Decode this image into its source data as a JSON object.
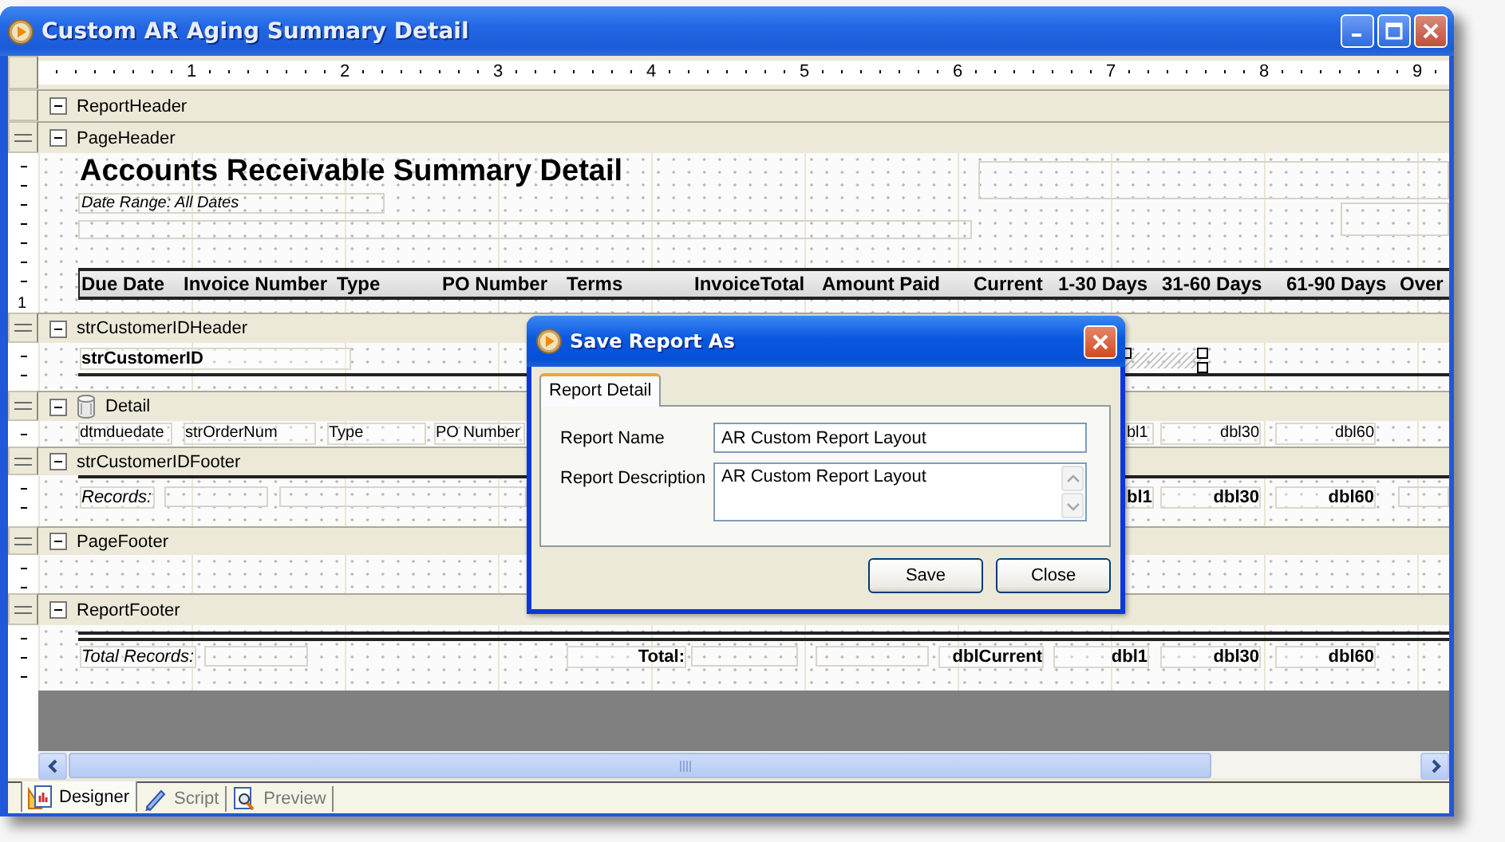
{
  "window": {
    "title": "Custom AR Aging Summary Detail"
  },
  "ruler": {
    "labels": [
      "1",
      "2",
      "3",
      "4",
      "5",
      "6",
      "7",
      "8",
      "9"
    ]
  },
  "sections": [
    {
      "label": "ReportHeader"
    },
    {
      "label": "PageHeader",
      "title": "Accounts Receivable Summary Detail",
      "subtitle": "Date Range: All Dates",
      "columns": [
        "Due Date",
        "Invoice Number",
        "Type",
        "PO Number",
        "Terms",
        "InvoiceTotal",
        "Amount Paid",
        "Current",
        "1-30 Days",
        "31-60 Days",
        "61-90 Days",
        "Over"
      ],
      "vertical_ruler_label": "1"
    },
    {
      "label": "strCustomerIDHeader",
      "fields": [
        {
          "text": "strCustomerID",
          "kind": "bold"
        }
      ]
    },
    {
      "label": "Detail",
      "fields": [
        {
          "text": "dtmduedate",
          "kind": "plain"
        },
        {
          "text": "strOrderNum",
          "kind": "plain"
        },
        {
          "text": "Type",
          "kind": "plain"
        },
        {
          "text": "PO Number",
          "kind": "plain"
        },
        {
          "text": "bl1",
          "kind": "plain"
        },
        {
          "text": "dbl30",
          "kind": "plain"
        },
        {
          "text": "dbl60",
          "kind": "plain"
        }
      ]
    },
    {
      "label": "strCustomerIDFooter",
      "fields": [
        {
          "text": "Records:",
          "kind": "italic"
        },
        {
          "text": "bl1",
          "kind": "bold"
        },
        {
          "text": "dbl30",
          "kind": "bold"
        },
        {
          "text": "dbl60",
          "kind": "bold"
        }
      ]
    },
    {
      "label": "PageFooter"
    },
    {
      "label": "ReportFooter",
      "fields": [
        {
          "text": "Total Records:",
          "kind": "italic"
        },
        {
          "text": "Total:",
          "kind": "bold"
        },
        {
          "text": "dblCurrent",
          "kind": "bold"
        },
        {
          "text": "dbl1",
          "kind": "bold"
        },
        {
          "text": "dbl30",
          "kind": "bold"
        },
        {
          "text": "dbl60",
          "kind": "bold"
        }
      ]
    }
  ],
  "dialog": {
    "title": "Save Report As",
    "tabs": [
      {
        "label": "Report Detail",
        "selected": true
      }
    ],
    "fields": [
      {
        "label": "Report Name",
        "value": "AR Custom Report Layout",
        "kind": "text"
      },
      {
        "label": "Report Description",
        "value": "AR Custom Report Layout",
        "kind": "textarea"
      }
    ],
    "buttons": [
      "Save",
      "Close"
    ]
  },
  "bottom_tabs": [
    {
      "label": "Designer",
      "selected": true
    },
    {
      "label": "Script",
      "selected": false
    },
    {
      "label": "Preview",
      "selected": false
    }
  ]
}
